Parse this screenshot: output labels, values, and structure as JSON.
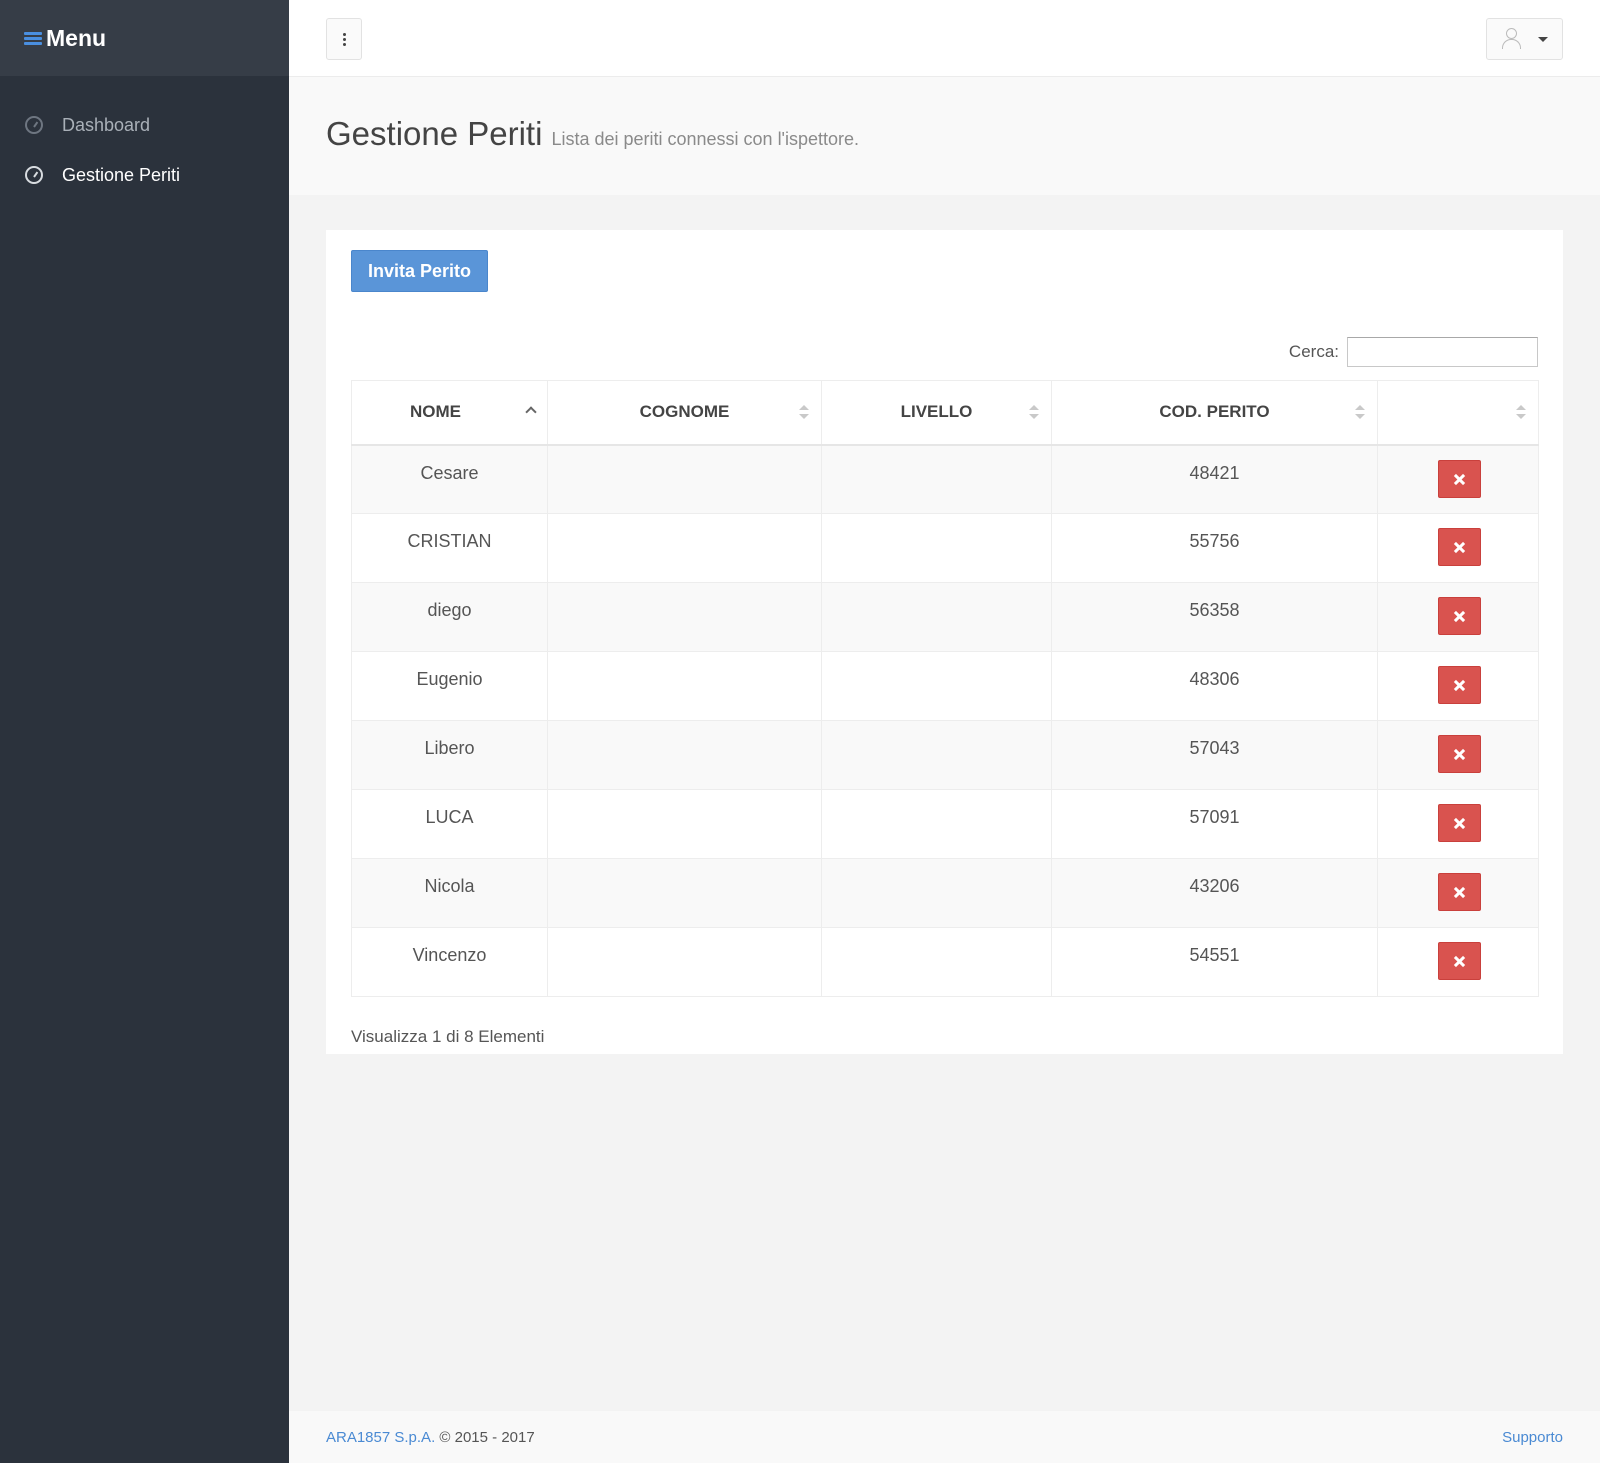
{
  "sidebar": {
    "title": "Menu",
    "items": [
      {
        "label": "Dashboard",
        "icon": "dashboard-icon",
        "active": false
      },
      {
        "label": "Gestione Periti",
        "icon": "dashboard-icon",
        "active": true
      }
    ]
  },
  "header": {
    "title": "Gestione Periti",
    "subtitle": "Lista dei periti connessi con l'ispettore."
  },
  "toolbar": {
    "invite_label": "Invita Perito"
  },
  "search": {
    "label": "Cerca:",
    "value": ""
  },
  "table": {
    "columns": [
      "NOME",
      "COGNOME",
      "LIVELLO",
      "COD. PERITO",
      ""
    ],
    "rows": [
      {
        "nome": "Cesare",
        "cognome": "",
        "livello": "",
        "cod": "48421"
      },
      {
        "nome": "CRISTIAN",
        "cognome": "",
        "livello": "",
        "cod": "55756"
      },
      {
        "nome": "diego",
        "cognome": "",
        "livello": "",
        "cod": "56358"
      },
      {
        "nome": "Eugenio",
        "cognome": "",
        "livello": "",
        "cod": "48306"
      },
      {
        "nome": "Libero",
        "cognome": "",
        "livello": "",
        "cod": "57043"
      },
      {
        "nome": "LUCA",
        "cognome": "",
        "livello": "",
        "cod": "57091"
      },
      {
        "nome": "Nicola",
        "cognome": "",
        "livello": "",
        "cod": "43206"
      },
      {
        "nome": "Vincenzo",
        "cognome": "",
        "livello": "",
        "cod": "54551"
      }
    ],
    "info": "Visualizza 1 di 8 Elementi"
  },
  "footer": {
    "company": "ARA1857 S.p.A.",
    "copyright": "© 2015 - 2017",
    "support": "Supporto"
  },
  "colors": {
    "sidebar_bg": "#2b323c",
    "primary": "#5a95d8",
    "danger": "#d9534f",
    "link": "#4a8ad3"
  }
}
